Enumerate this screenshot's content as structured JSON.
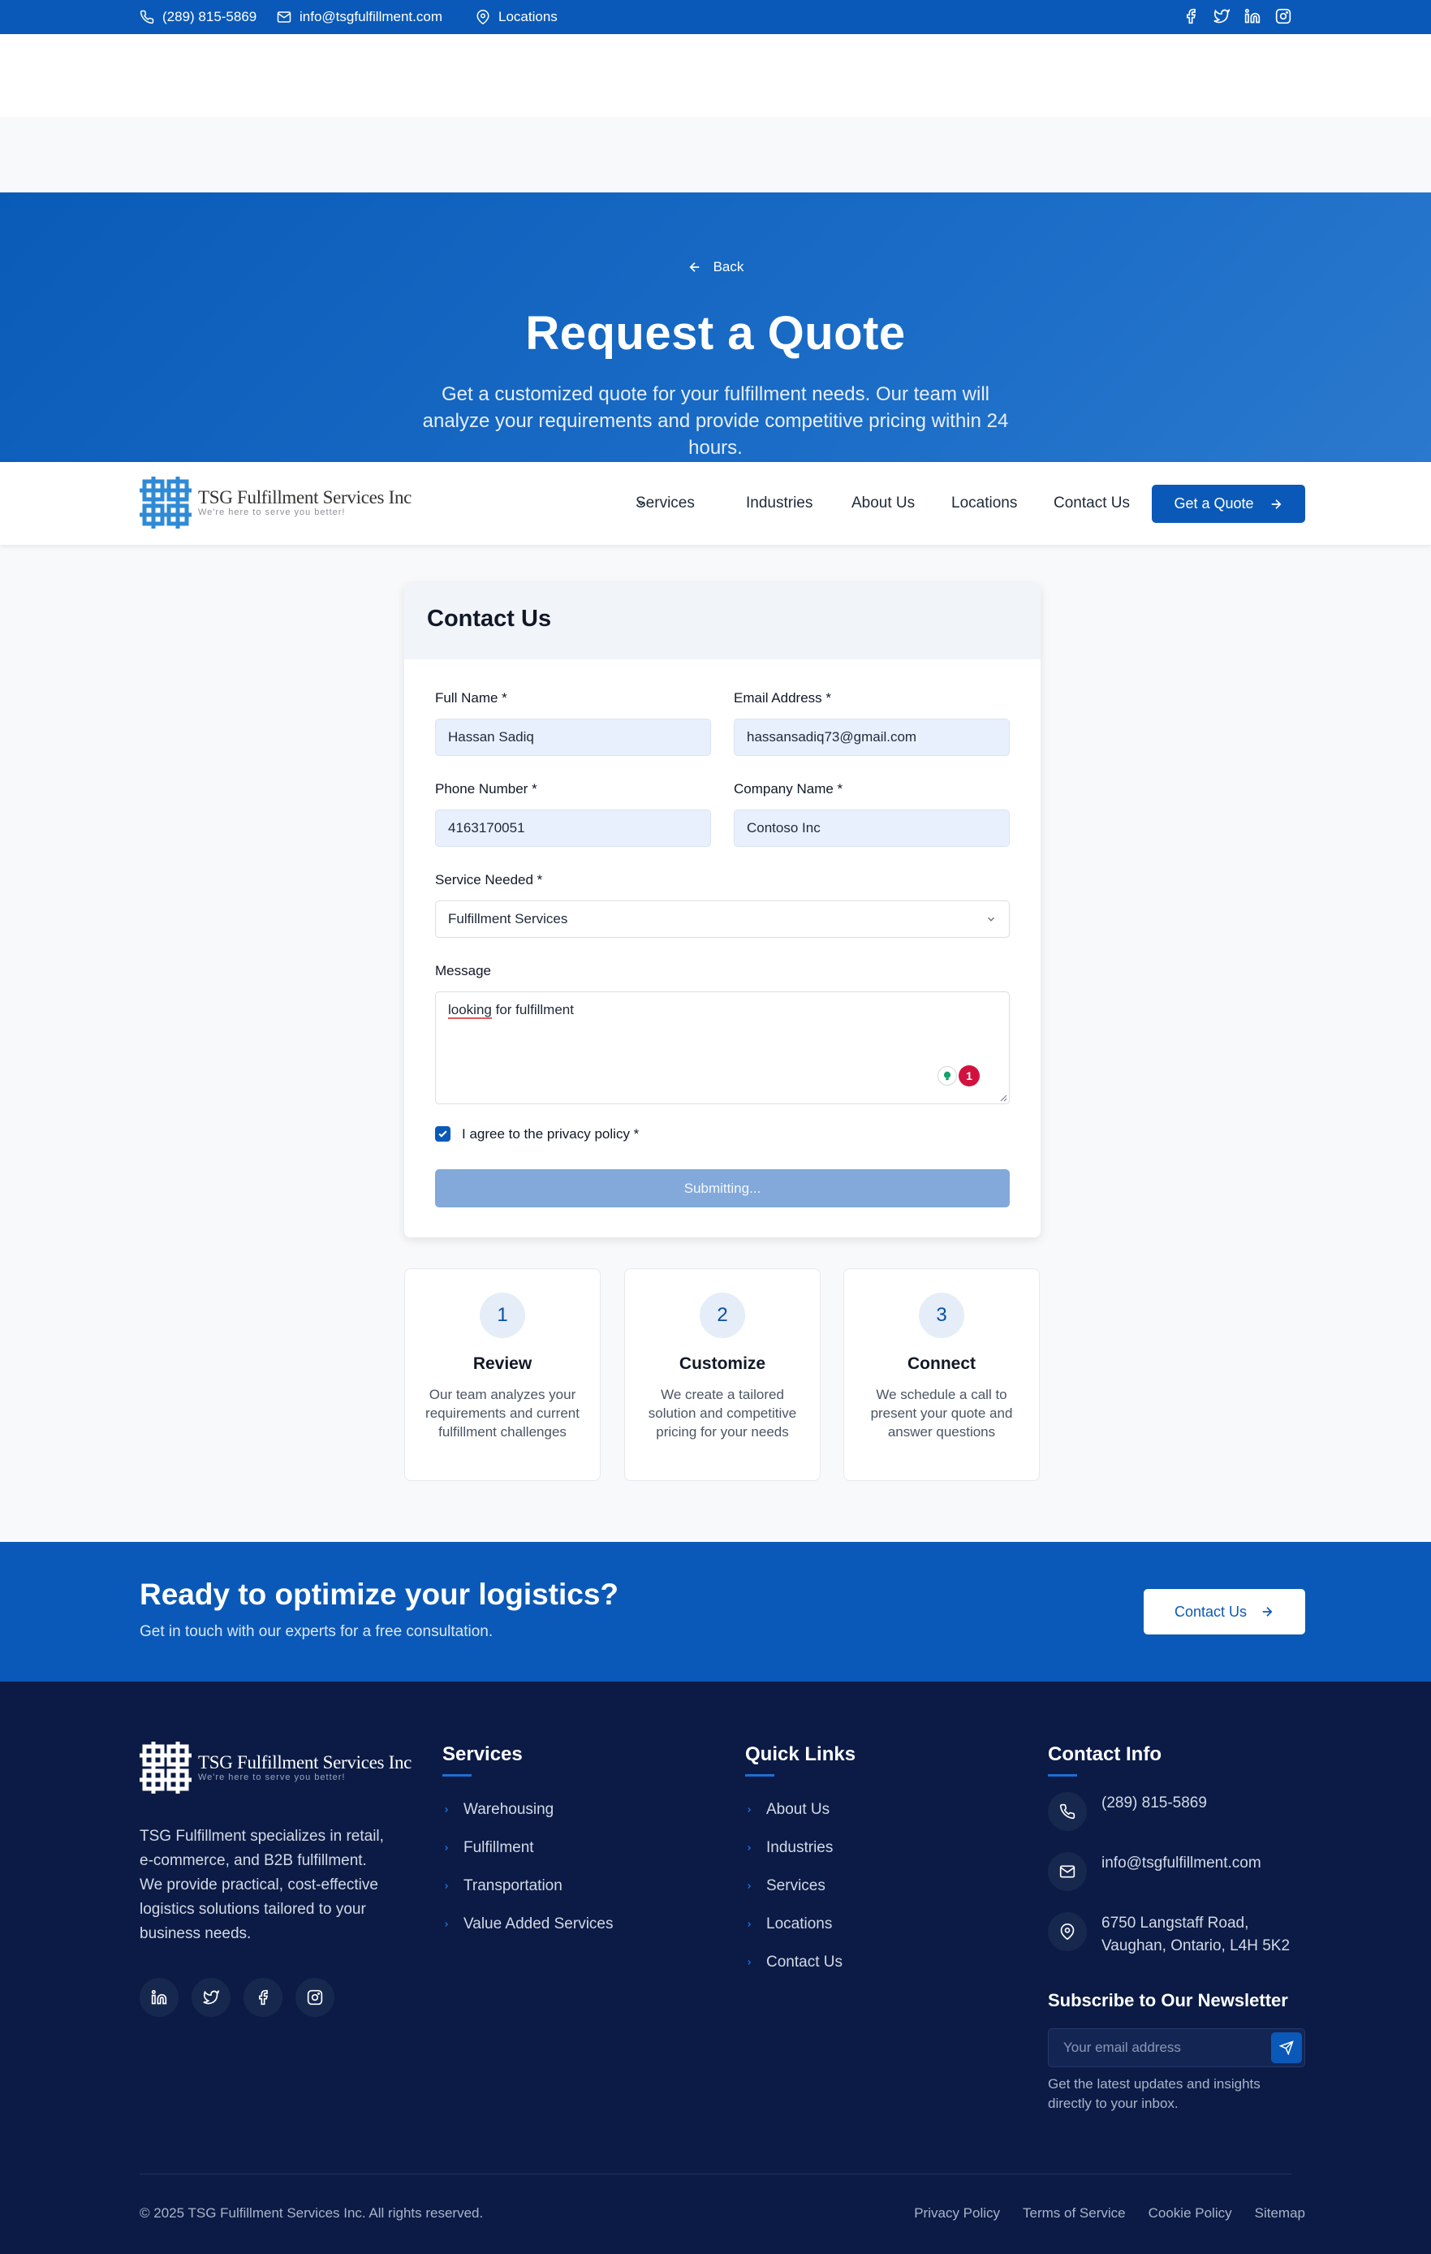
{
  "topbar": {
    "phone": "(289) 815-5869",
    "email": "info@tsgfulfillment.com",
    "locations": "Locations",
    "social_icons": [
      "facebook-icon",
      "twitter-icon",
      "linkedin-icon",
      "instagram-icon"
    ]
  },
  "hero": {
    "back": "Back",
    "title": "Request a Quote",
    "subtitle": "Get a customized quote for your fulfillment needs. Our team will analyze your requirements and provide competitive pricing within 24 hours."
  },
  "brand": {
    "name": "TSG Fulfillment Services Inc",
    "tagline": "We're here to serve you better!"
  },
  "nav": {
    "services": "Services",
    "industries": "Industries",
    "about": "About Us",
    "locations": "Locations",
    "contact": "Contact Us",
    "quote_button": "Get a Quote"
  },
  "form": {
    "title": "Contact Us",
    "full_name_label": "Full Name *",
    "full_name_value": "Hassan Sadiq",
    "email_label": "Email Address *",
    "email_value": "hassansadiq73@gmail.com",
    "phone_label": "Phone Number *",
    "phone_value": "4163170051",
    "company_label": "Company Name *",
    "company_value": "Contoso Inc",
    "service_label": "Service Needed *",
    "service_value": "Fulfillment Services",
    "message_label": "Message",
    "message_first_word": "looking",
    "message_rest": " for fulfillment",
    "grammar_count": "1",
    "privacy_label": "I agree to the privacy policy *",
    "privacy_checked": true,
    "submit_label": "Submitting..."
  },
  "steps": [
    {
      "num": "1",
      "title": "Review",
      "text": "Our team analyzes your requirements and current fulfillment challenges"
    },
    {
      "num": "2",
      "title": "Customize",
      "text": "We create a tailored solution and competitive pricing for your needs"
    },
    {
      "num": "3",
      "title": "Connect",
      "text": "We schedule a call to present your quote and answer questions"
    }
  ],
  "cta": {
    "title": "Ready to optimize your logistics?",
    "subtitle": "Get in touch with our experts for a free consultation.",
    "button": "Contact Us"
  },
  "footer": {
    "description": "TSG Fulfillment specializes in retail, e-commerce, and B2B fulfillment. We provide practical, cost-effective logistics solutions tailored to your business needs.",
    "services_title": "Services",
    "services": [
      "Warehousing",
      "Fulfillment",
      "Transportation",
      "Value Added Services"
    ],
    "quick_title": "Quick Links",
    "quick_links": [
      "About Us",
      "Industries",
      "Services",
      "Locations",
      "Contact Us"
    ],
    "contact_title": "Contact Info",
    "contact_phone": "(289) 815-5869",
    "contact_email": "info@tsgfulfillment.com",
    "address_line1": "6750 Langstaff Road,",
    "address_line2": "Vaughan, Ontario, L4H 5K2",
    "newsletter_title": "Subscribe to Our Newsletter",
    "newsletter_placeholder": "Your email address",
    "newsletter_note": "Get the latest updates and insights directly to your inbox.",
    "copyright": "© 2025 TSG Fulfillment Services Inc. All rights reserved.",
    "legal": [
      "Privacy Policy",
      "Terms of Service",
      "Cookie Policy",
      "Sitemap"
    ]
  },
  "colors": {
    "primary": "#0a59b8",
    "footer_bg": "#0b1b45",
    "submit_disabled": "#82a9d9"
  }
}
